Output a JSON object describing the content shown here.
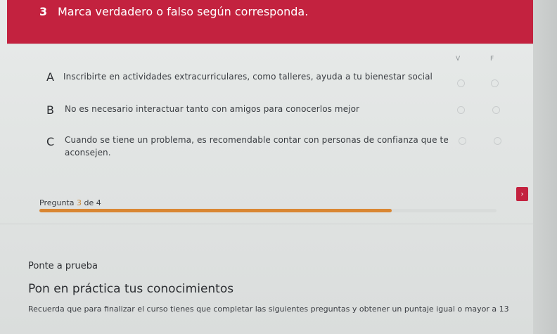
{
  "question": {
    "number": "3",
    "title": "Marca verdadero o falso según corresponda."
  },
  "columns": {
    "true_label": "V",
    "false_label": "F"
  },
  "items": [
    {
      "letter": "A",
      "line1": "Inscribirte en actividades extracurriculares, como talleres, ayuda a tu bienestar social",
      "line2": ""
    },
    {
      "letter": "B",
      "line1": "No es necesario interactuar tanto con amigos para conocerlos mejor",
      "line2": ""
    },
    {
      "letter": "C",
      "line1": "Cuando se tiene un problema, es recomendable contar con personas de confianza que te",
      "line2": "aconsejen."
    }
  ],
  "progress": {
    "label": "Pregunta",
    "current": "3",
    "of_label": "de",
    "total": "4",
    "fraction": 0.77
  },
  "next_button": {
    "icon": "chevron-right-icon",
    "glyph": "›"
  },
  "section": {
    "subtitle": "Ponte a prueba",
    "title": "Pon en práctica tus conocimientos",
    "description": "Recuerda que para finalizar el curso tienes que completar las siguientes preguntas y obtener un puntaje igual o mayor a 13"
  },
  "colors": {
    "header_bg": "#c3223f",
    "progress_fill": "#d98632",
    "next_button_bg": "#c3223f"
  }
}
